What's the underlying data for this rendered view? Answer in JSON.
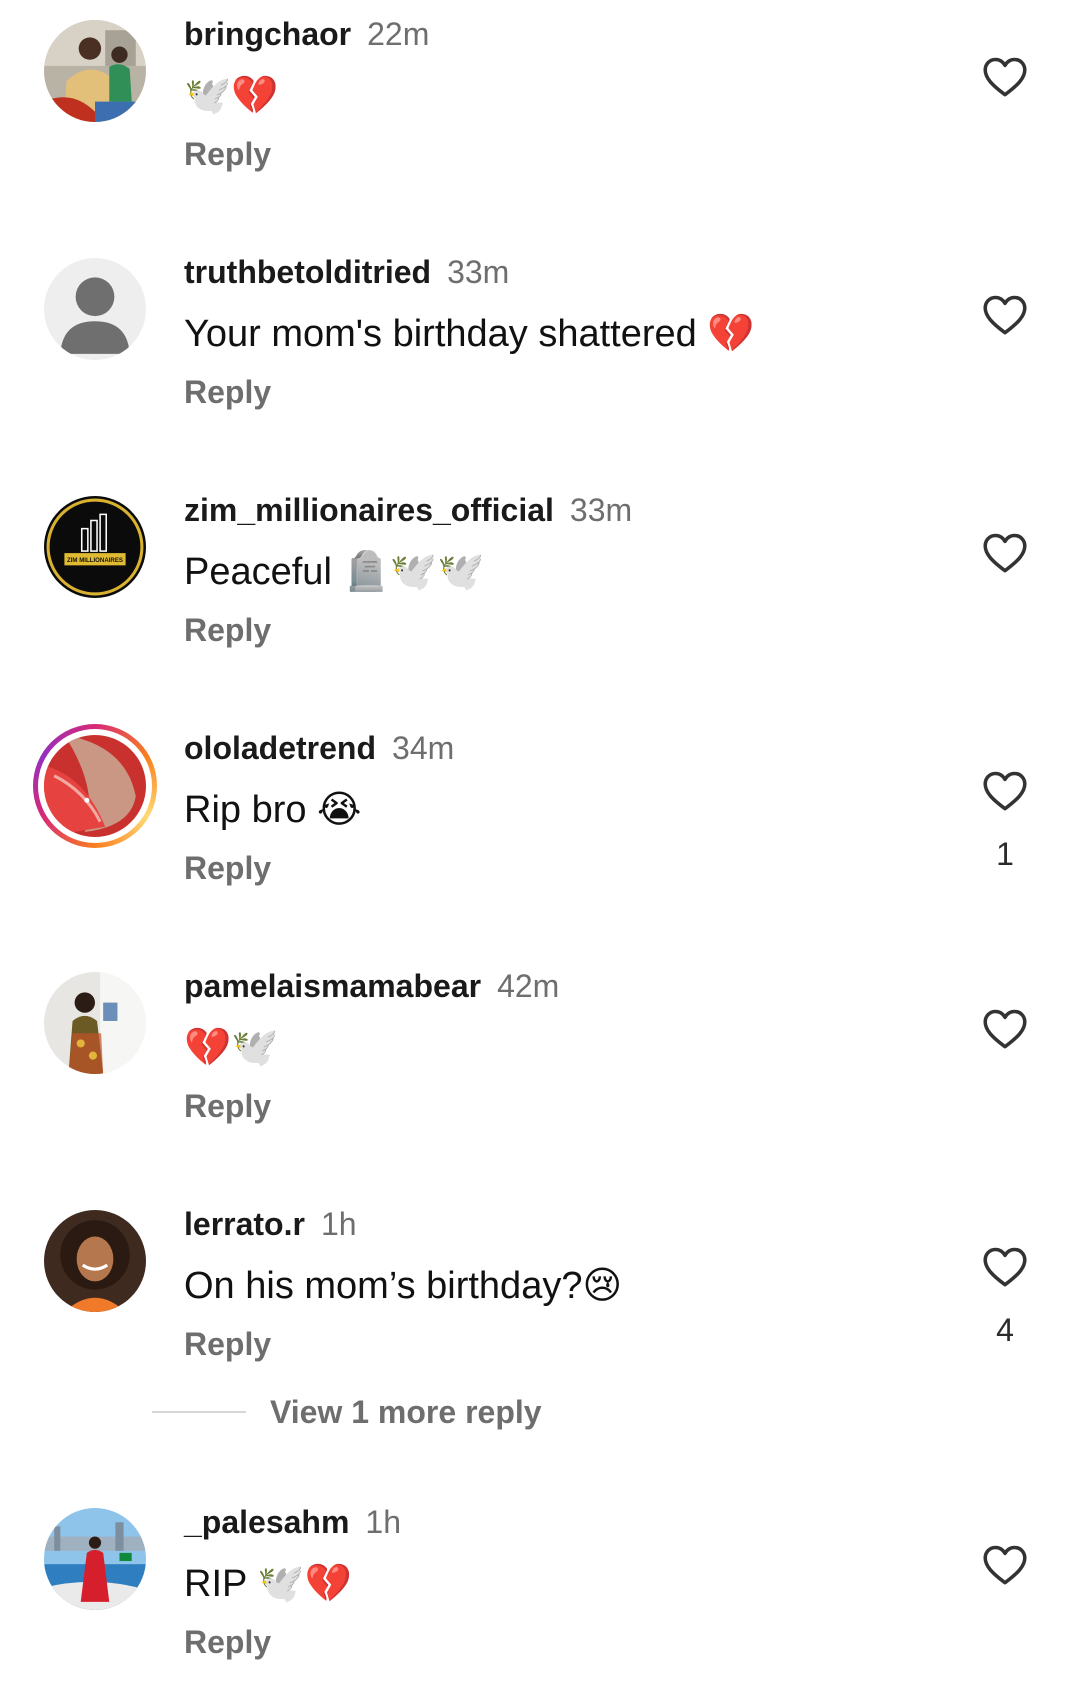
{
  "comments": [
    {
      "username": "bringchaor",
      "time": "22m",
      "text": "🕊️💔",
      "reply": "Reply",
      "likes": ""
    },
    {
      "username": "truthbetolditried",
      "time": "33m",
      "text": "Your mom's birthday shattered 💔",
      "reply": "Reply",
      "likes": ""
    },
    {
      "username": "zim_millionaires_official",
      "time": "33m",
      "text": "Peaceful 🪦🕊️🕊️",
      "reply": "Reply",
      "likes": ""
    },
    {
      "username": "ololadetrend",
      "time": "34m",
      "text": "Rip bro 😭",
      "reply": "Reply",
      "likes": "1"
    },
    {
      "username": "pamelaismamabear",
      "time": "42m",
      "text": "💔🕊️",
      "reply": "Reply",
      "likes": ""
    },
    {
      "username": "lerrato.r",
      "time": "1h",
      "text": "On his mom’s birthday?😢",
      "reply": "Reply",
      "likes": "4"
    },
    {
      "username": "_palesahm",
      "time": "1h",
      "text": "RIP 🕊️💔",
      "reply": "Reply",
      "likes": ""
    }
  ],
  "view_more_replies": "View 1 more reply",
  "logo_text": "ZIM MILLIONAIRES",
  "icons": {
    "like": "heart-outline-icon",
    "default_avatar": "person-silhouette-icon"
  },
  "colors": {
    "secondary_text": "#6e6e6e",
    "story_ring_start": "#d62976",
    "story_ring_end": "#feda75"
  }
}
